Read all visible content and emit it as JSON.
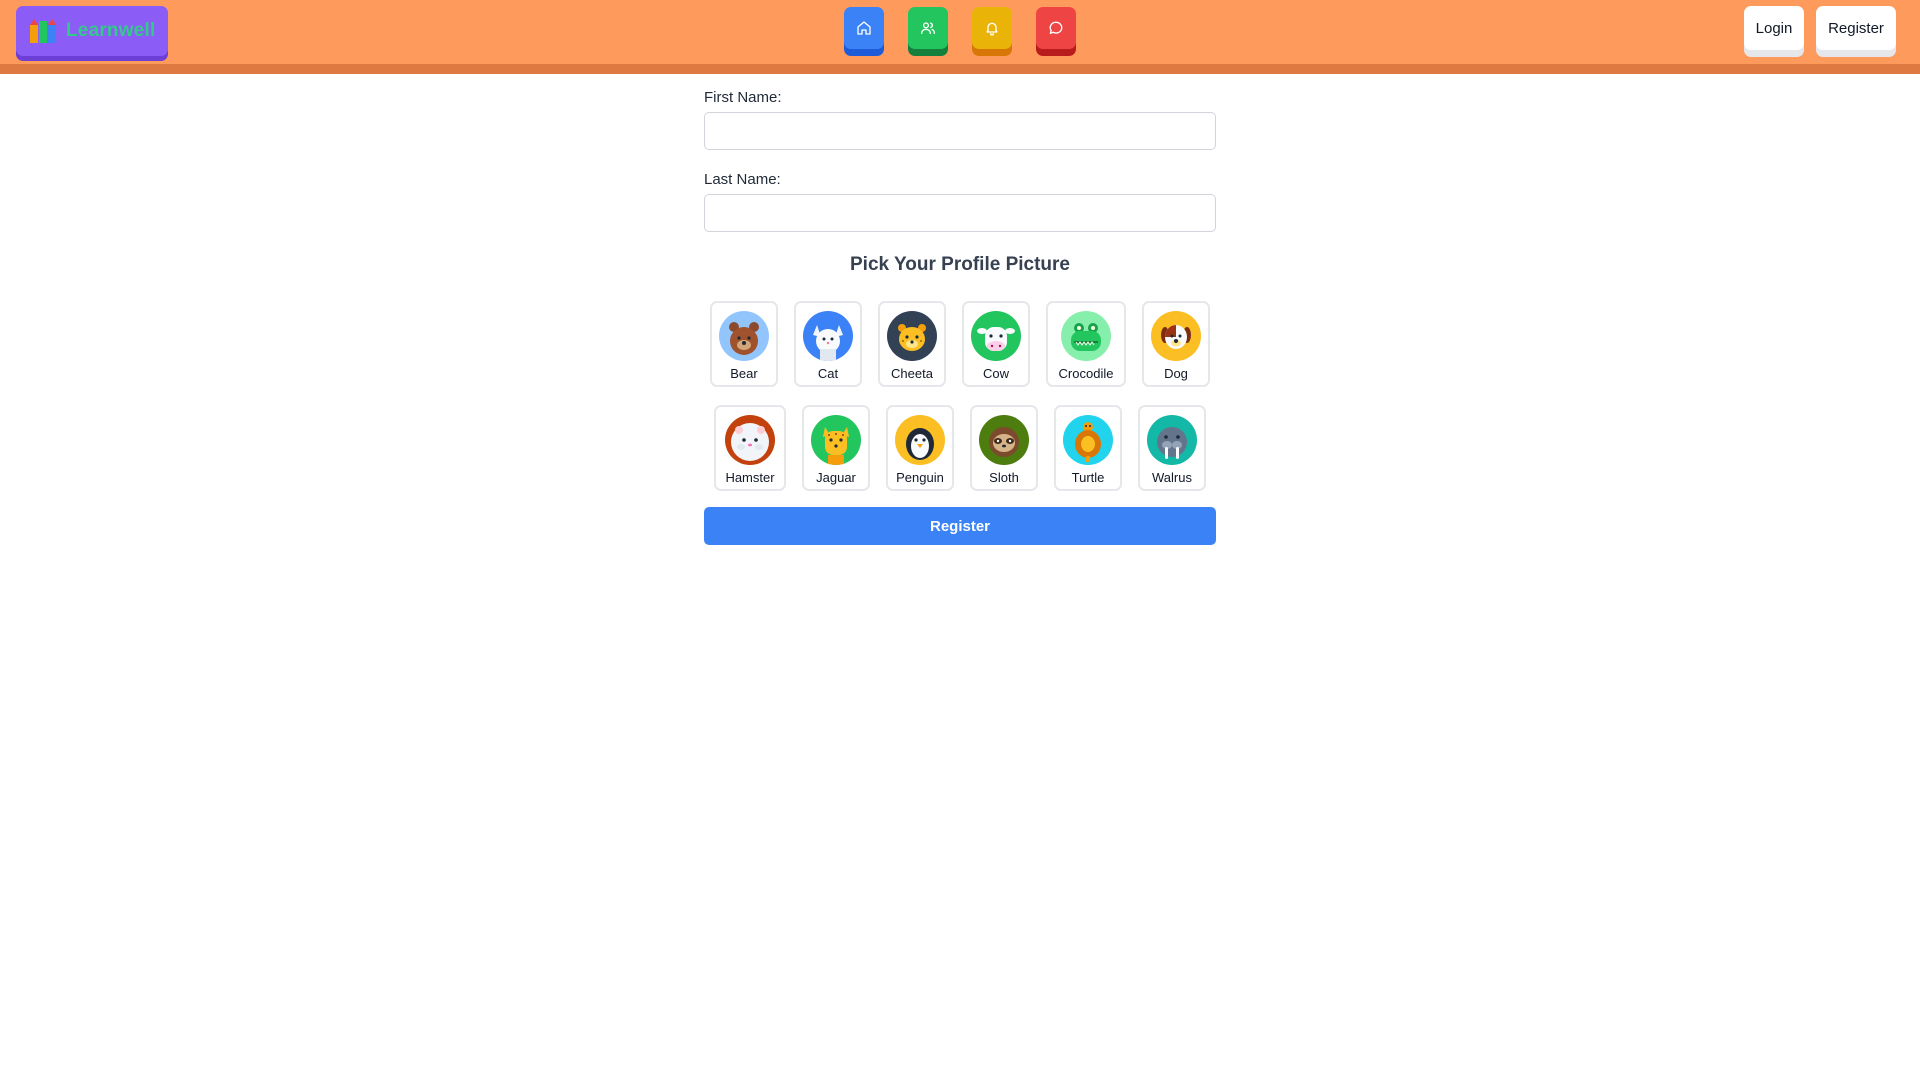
{
  "header": {
    "brand": "Learnwell",
    "nav": [
      {
        "icon": "home-icon",
        "color": "#3b82f6"
      },
      {
        "icon": "users-icon",
        "color": "#22c55e"
      },
      {
        "icon": "bell-icon",
        "color": "#eab308"
      },
      {
        "icon": "chat-icon",
        "color": "#ef4444"
      }
    ],
    "login_label": "Login",
    "register_label": "Register",
    "bar_color": "#fe9a5c"
  },
  "form": {
    "first_name_label": "First Name:",
    "first_name_value": "",
    "last_name_label": "Last Name:",
    "last_name_value": "",
    "pick_title": "Pick Your Profile Picture",
    "submit_label": "Register",
    "avatars_row1": [
      {
        "name": "Bear",
        "icon": "bear-icon",
        "bg": "#93c5fd"
      },
      {
        "name": "Cat",
        "icon": "cat-icon",
        "bg": "#3b82f6"
      },
      {
        "name": "Cheeta",
        "icon": "cheetah-icon",
        "bg": "#334155"
      },
      {
        "name": "Cow",
        "icon": "cow-icon",
        "bg": "#22c55e"
      },
      {
        "name": "Crocodile",
        "icon": "crocodile-icon",
        "bg": "#86efac"
      },
      {
        "name": "Dog",
        "icon": "dog-icon",
        "bg": "#fbbf24"
      }
    ],
    "avatars_row2": [
      {
        "name": "Hamster",
        "icon": "hamster-icon",
        "bg": "#c2410c"
      },
      {
        "name": "Jaguar",
        "icon": "jaguar-icon",
        "bg": "#22c55e"
      },
      {
        "name": "Penguin",
        "icon": "penguin-icon",
        "bg": "#fbbf24"
      },
      {
        "name": "Sloth",
        "icon": "sloth-icon",
        "bg": "#4d7c0f"
      },
      {
        "name": "Turtle",
        "icon": "turtle-icon",
        "bg": "#22d3ee"
      },
      {
        "name": "Walrus",
        "icon": "walrus-icon",
        "bg": "#14b8a6"
      }
    ]
  }
}
